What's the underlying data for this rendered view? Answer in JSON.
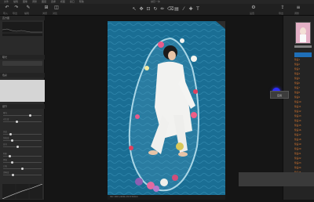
{
  "menu": {
    "items": [
      "文件",
      "编辑",
      "图像",
      "调整",
      "图层",
      "选择",
      "视图",
      "窗口",
      "帮助"
    ],
    "app_title": "捕获一体"
  },
  "toolbar": {
    "labels": [
      "导入",
      "导出",
      "编辑",
      "浏览",
      "对比",
      "设置",
      "导出",
      "调整"
    ]
  },
  "left_panel": {
    "headers": [
      "直方图",
      "曝光",
      "色彩",
      "细节"
    ],
    "slider_labels": [
      "曝光",
      "对比度",
      "亮度",
      "饱和度",
      "高光",
      "阴影",
      "黑色",
      "白色",
      "清晰度"
    ],
    "slider_levels": [
      0.72,
      0.34,
      0.18,
      0.21,
      0.38,
      0.16,
      0.22,
      0.5,
      0.23
    ]
  },
  "right_panel": {
    "presets": [
      "预设1",
      "预设2",
      "预设3",
      "预设4",
      "预设5",
      "预设6",
      "预设7",
      "预设8",
      "预设9",
      "预设10",
      "预设11",
      "预设12",
      "预设13",
      "预设14",
      "预设15",
      "预设16",
      "预设17",
      "预设18",
      "预设19",
      "预设20",
      "预设21",
      "预设22",
      "预设23",
      "预设24",
      "预设25",
      "预设26"
    ]
  },
  "tooltip": {
    "text": "应用"
  },
  "info_bar": {
    "text": "ISO 100  1/200s  f/2.8  50mm"
  },
  "colors": {
    "accent": "#e37b2f",
    "water": "#1a6e94",
    "panel": "#2a2a2a"
  }
}
